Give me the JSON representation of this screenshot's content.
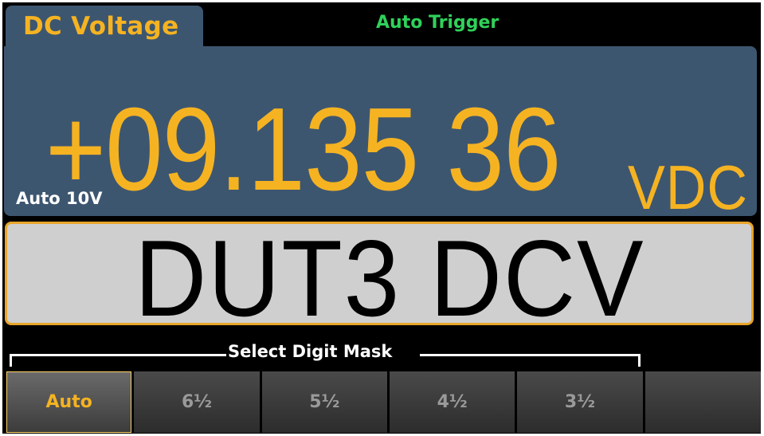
{
  "header": {
    "function_label": "DC Voltage",
    "trigger_label": "Auto Trigger"
  },
  "measurement": {
    "reading": "+09.135 36",
    "unit": "VDC",
    "range": "Auto 10V"
  },
  "label_display": {
    "text": "DUT3 DCV"
  },
  "softkeys": {
    "group_title": "Select Digit Mask",
    "keys": [
      {
        "label": "Auto",
        "selected": true
      },
      {
        "label": "6½",
        "selected": false
      },
      {
        "label": "5½",
        "selected": false
      },
      {
        "label": "4½",
        "selected": false
      },
      {
        "label": "3½",
        "selected": false
      },
      {
        "label": "",
        "selected": false
      }
    ]
  },
  "colors": {
    "panel": "#3d5670",
    "reading": "#f5b322",
    "trigger": "#2fd15a",
    "label_border": "#e8a52a",
    "label_bg": "#cfcfcf"
  }
}
